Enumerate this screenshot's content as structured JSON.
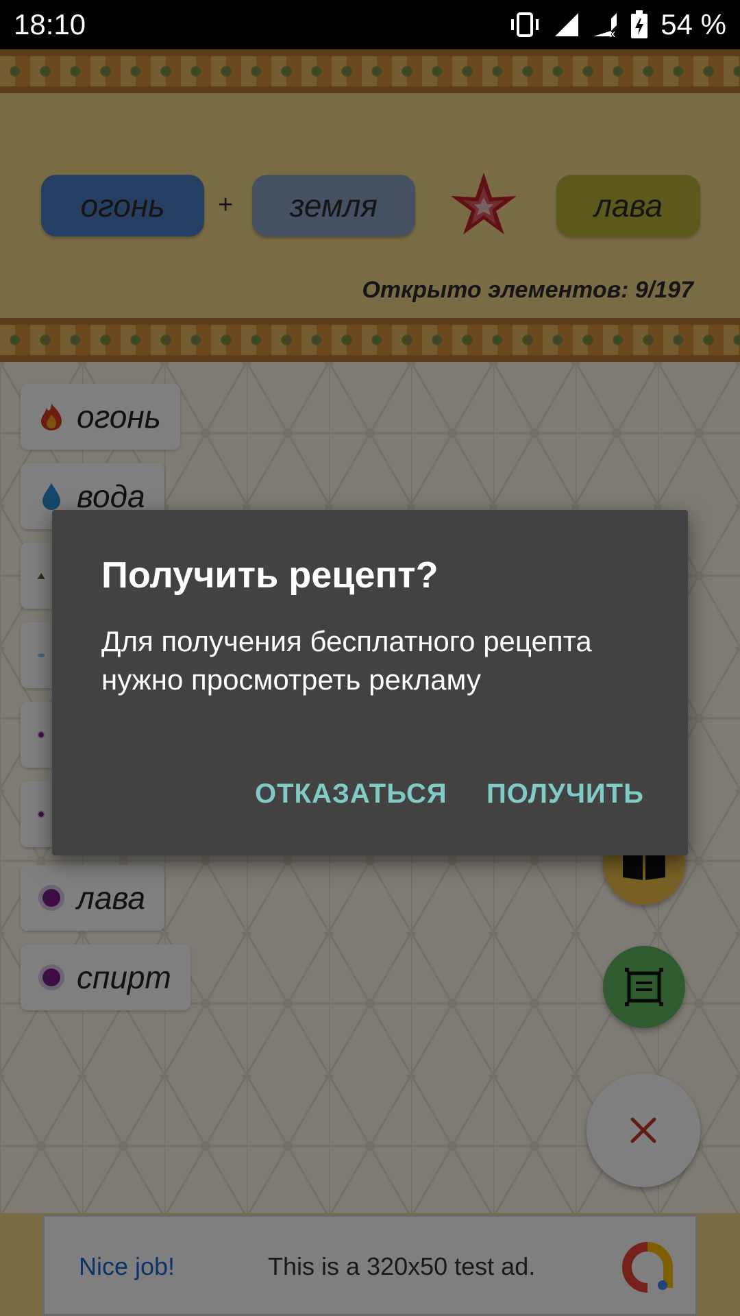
{
  "status_bar": {
    "time": "18:10",
    "battery": "54 %",
    "icons": [
      "vibrate-icon",
      "signal-icon",
      "signal-no-data-icon",
      "battery-charging-icon"
    ]
  },
  "header": {
    "first_element": "огонь",
    "plus": "+",
    "second_element": "земля",
    "result_element": "лава",
    "opened_counter": "Открыто элементов: 9/197",
    "colors": {
      "first": "#4a7ec6",
      "second": "#8aa0c0",
      "result": "#b8b23b"
    }
  },
  "elements": [
    {
      "label": "огонь",
      "icon": "fire-icon"
    },
    {
      "label": "вода",
      "icon": "water-drop-icon"
    },
    {
      "label": "",
      "icon": "earth-icon"
    },
    {
      "label": "",
      "icon": "air-icon"
    },
    {
      "label": "",
      "icon": "purple-dot-icon"
    },
    {
      "label": "",
      "icon": "purple-dot-icon"
    },
    {
      "label": "лава",
      "icon": "purple-dot-icon"
    },
    {
      "label": "спирт",
      "icon": "purple-dot-icon"
    }
  ],
  "fabs": {
    "book": "book-icon",
    "green": "board-icon",
    "close": "close-icon"
  },
  "ad": {
    "headline": "Nice job!",
    "text": "This is a 320x50 test ad."
  },
  "dialog": {
    "title": "Получить рецепт?",
    "body": "Для получения бесплатного рецепта нужно просмотреть рекламу",
    "cancel_label": "ОТКАЗАТЬСЯ",
    "ok_label": "ПОЛУЧИТЬ",
    "accent_color": "#80cbc4"
  }
}
